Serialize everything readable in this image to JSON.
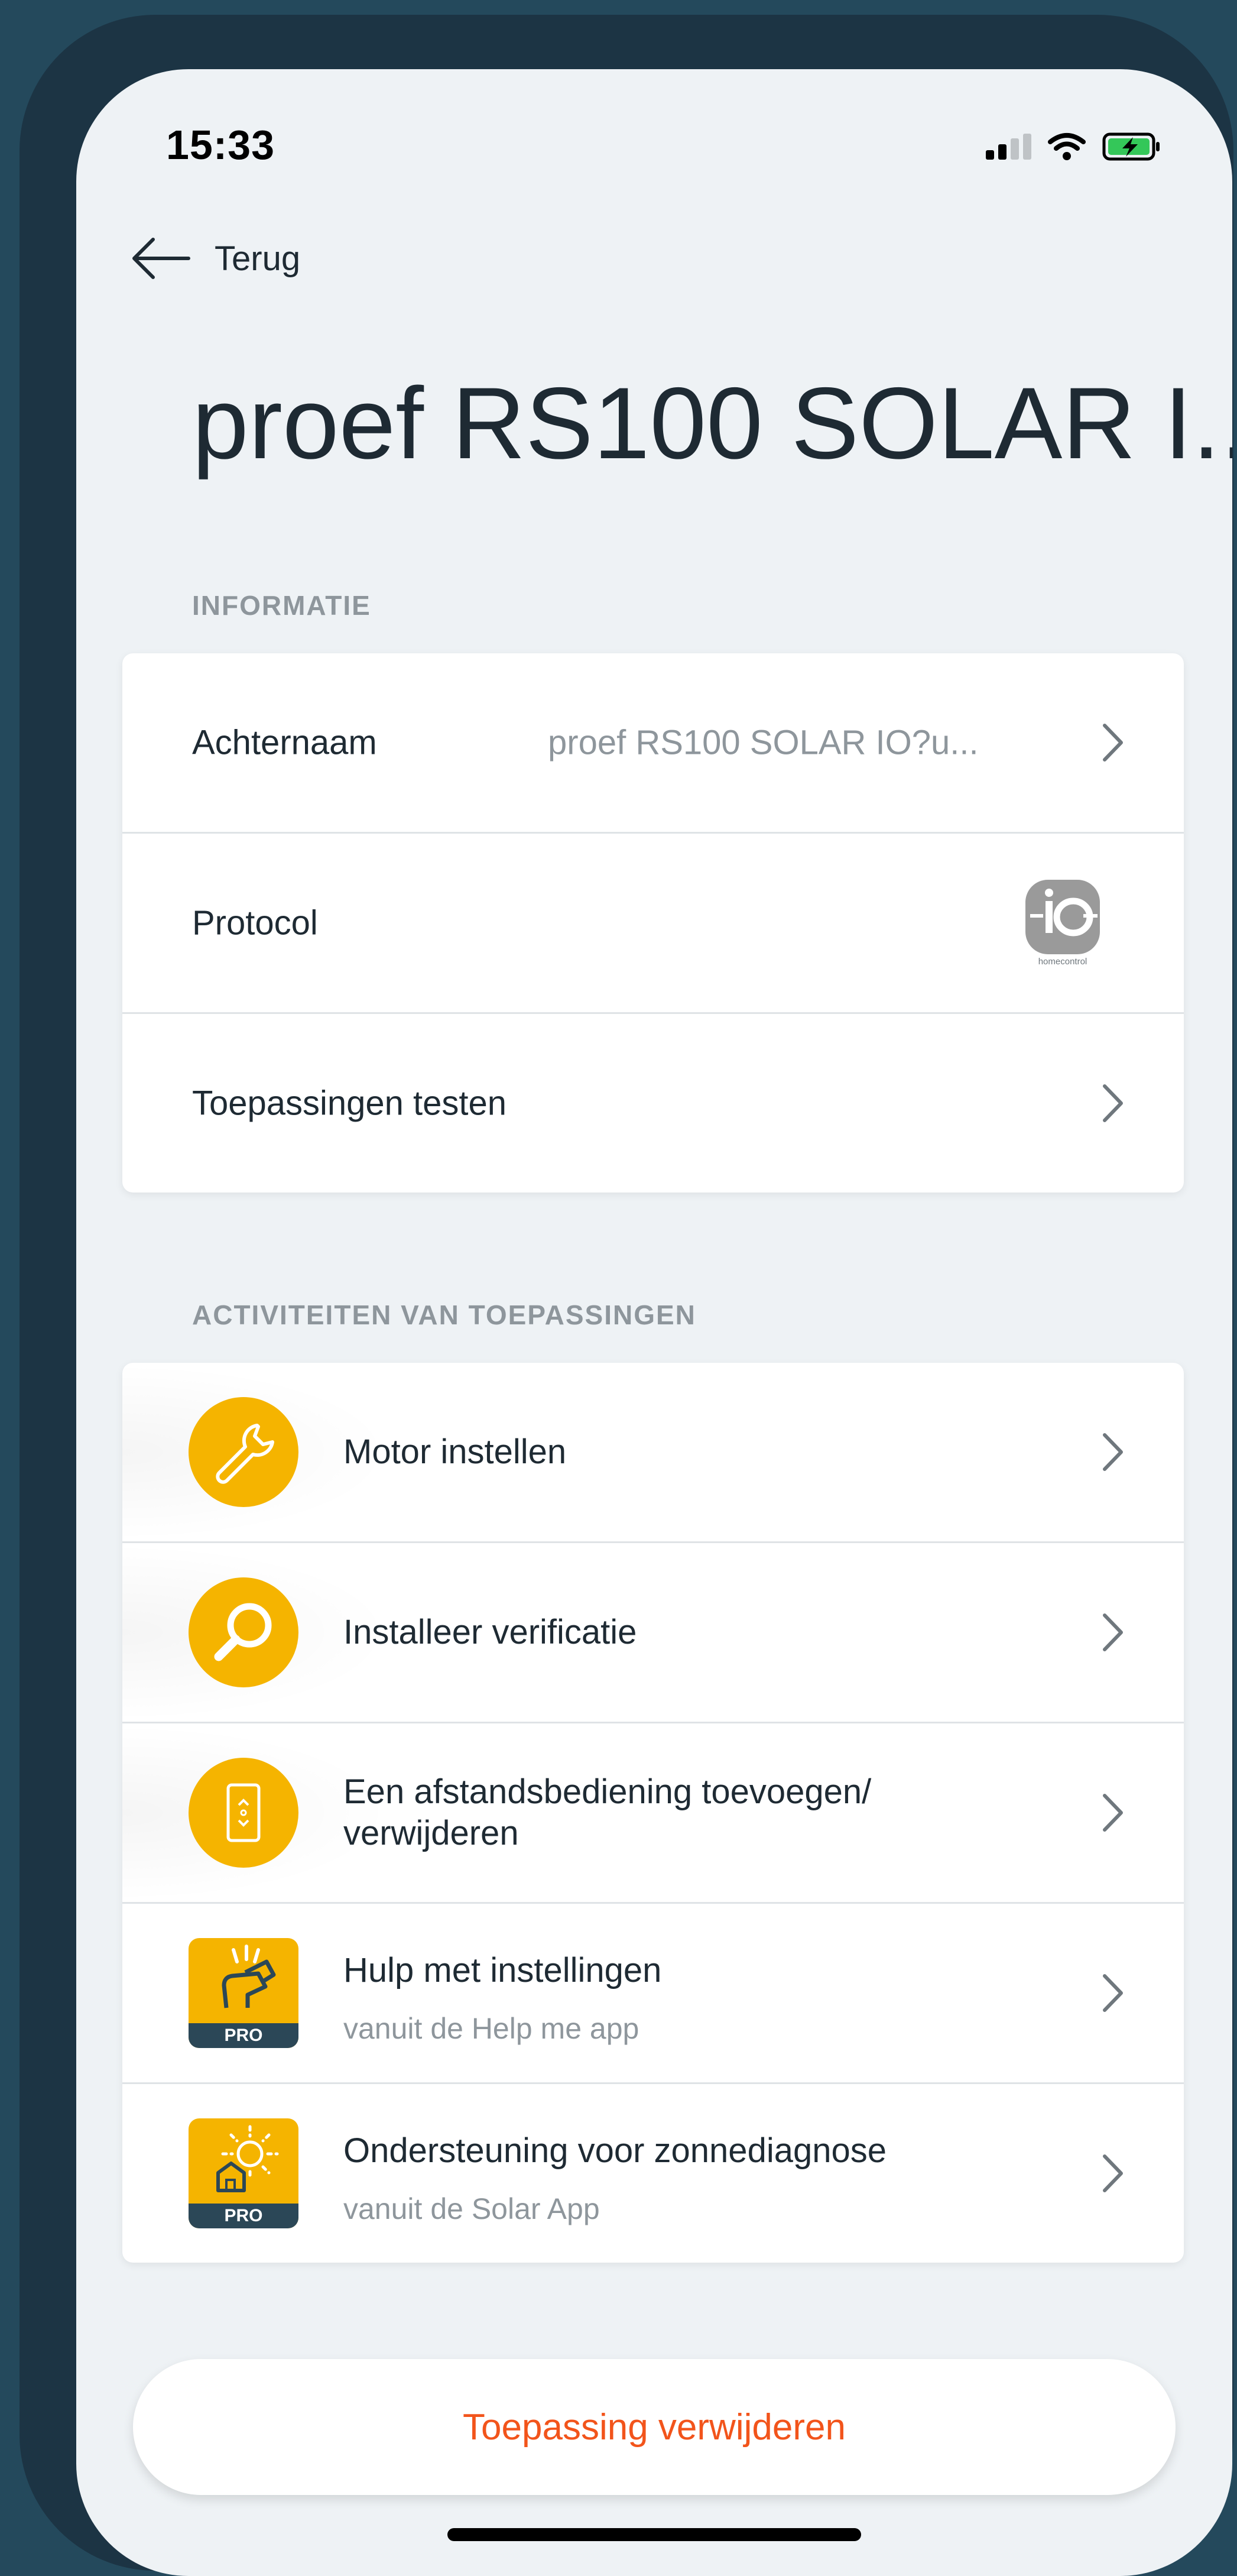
{
  "status_bar": {
    "time": "15:33"
  },
  "nav": {
    "back_label": "Terug"
  },
  "page": {
    "title": "proef RS100 SOLAR I..."
  },
  "information": {
    "header": "INFORMATIE",
    "rows": [
      {
        "label": "Achternaam",
        "value": "proef RS100 SOLAR IO?u..."
      },
      {
        "label": "Protocol",
        "logo_text": "io",
        "logo_sub": "homecontrol"
      },
      {
        "label": "Toepassingen testen"
      }
    ]
  },
  "activities": {
    "header": "ACTIVITEITEN VAN TOEPASSINGEN",
    "items": [
      {
        "label": "Motor instellen",
        "icon": "wrench-icon"
      },
      {
        "label": "Installeer verificatie",
        "icon": "magnifier-icon"
      },
      {
        "label": "Een afstandsbediening toevoegen/ verwijderen",
        "icon": "remote-icon"
      },
      {
        "label": "Hulp met instellingen",
        "sub": "vanuit de Help me app",
        "badge": "PRO",
        "icon": "help-me-app-icon"
      },
      {
        "label": "Ondersteuning voor zonnediagnose",
        "sub": "vanuit de Solar App",
        "badge": "PRO",
        "icon": "solar-app-icon"
      }
    ]
  },
  "actions": {
    "delete_label": "Toepassing verwijderen"
  },
  "colors": {
    "accent": "#f5b400",
    "danger": "#f2541b",
    "background": "#eef2f5"
  }
}
